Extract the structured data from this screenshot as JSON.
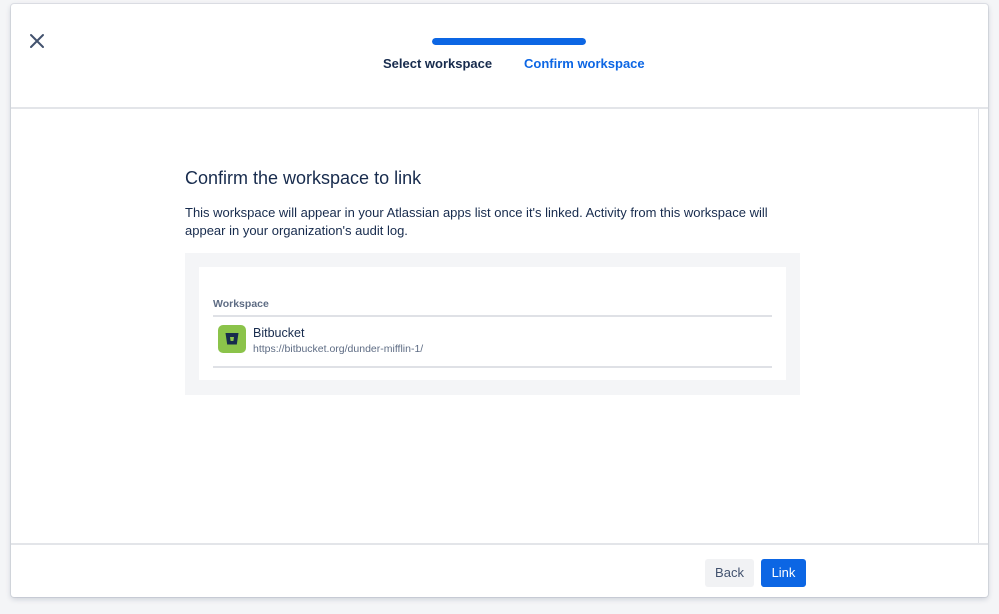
{
  "header": {
    "progress_percent": 100,
    "steps": [
      {
        "label": "Select workspace",
        "state": "completed"
      },
      {
        "label": "Confirm workspace",
        "state": "current"
      }
    ],
    "close_icon": "close-icon"
  },
  "main": {
    "title": "Confirm the workspace to link",
    "description": "This workspace will appear in your Atlassian apps list once it's linked. Activity from this workspace will appear in your organization's audit log.",
    "table": {
      "column_header": "Workspace",
      "rows": [
        {
          "icon": "bitbucket-icon",
          "name": "Bitbucket",
          "url": "https://bitbucket.org/dunder-mifflin-1/"
        }
      ]
    }
  },
  "footer": {
    "back_label": "Back",
    "link_label": "Link"
  },
  "colors": {
    "primary": "#0c66e4",
    "text": "#172b4d",
    "subtle_text": "#5e6c84",
    "bitbucket_green": "#8bc34a"
  }
}
